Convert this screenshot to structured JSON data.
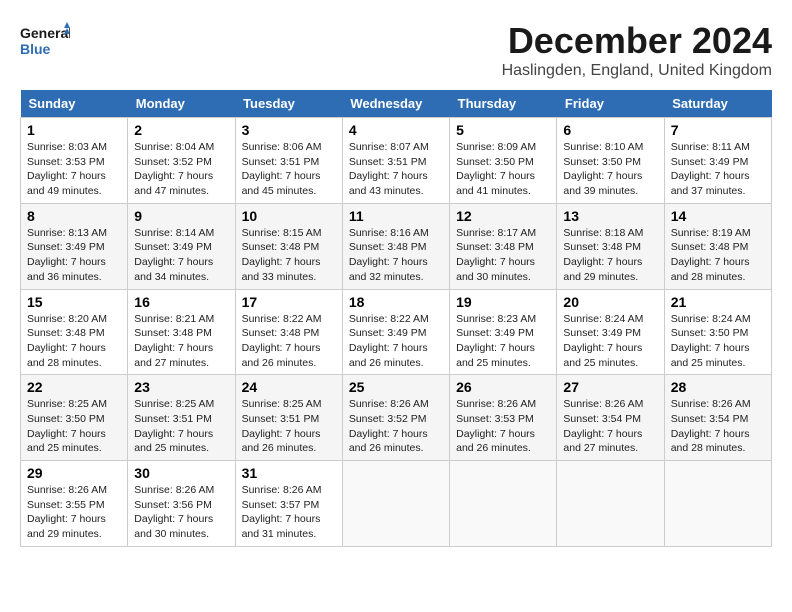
{
  "header": {
    "logo_line1": "General",
    "logo_line2": "Blue",
    "title": "December 2024",
    "subtitle": "Haslingden, England, United Kingdom"
  },
  "weekdays": [
    "Sunday",
    "Monday",
    "Tuesday",
    "Wednesday",
    "Thursday",
    "Friday",
    "Saturday"
  ],
  "weeks": [
    [
      {
        "day": "1",
        "sunrise": "Sunrise: 8:03 AM",
        "sunset": "Sunset: 3:53 PM",
        "daylight": "Daylight: 7 hours",
        "minutes": "and 49 minutes."
      },
      {
        "day": "2",
        "sunrise": "Sunrise: 8:04 AM",
        "sunset": "Sunset: 3:52 PM",
        "daylight": "Daylight: 7 hours",
        "minutes": "and 47 minutes."
      },
      {
        "day": "3",
        "sunrise": "Sunrise: 8:06 AM",
        "sunset": "Sunset: 3:51 PM",
        "daylight": "Daylight: 7 hours",
        "minutes": "and 45 minutes."
      },
      {
        "day": "4",
        "sunrise": "Sunrise: 8:07 AM",
        "sunset": "Sunset: 3:51 PM",
        "daylight": "Daylight: 7 hours",
        "minutes": "and 43 minutes."
      },
      {
        "day": "5",
        "sunrise": "Sunrise: 8:09 AM",
        "sunset": "Sunset: 3:50 PM",
        "daylight": "Daylight: 7 hours",
        "minutes": "and 41 minutes."
      },
      {
        "day": "6",
        "sunrise": "Sunrise: 8:10 AM",
        "sunset": "Sunset: 3:50 PM",
        "daylight": "Daylight: 7 hours",
        "minutes": "and 39 minutes."
      },
      {
        "day": "7",
        "sunrise": "Sunrise: 8:11 AM",
        "sunset": "Sunset: 3:49 PM",
        "daylight": "Daylight: 7 hours",
        "minutes": "and 37 minutes."
      }
    ],
    [
      {
        "day": "8",
        "sunrise": "Sunrise: 8:13 AM",
        "sunset": "Sunset: 3:49 PM",
        "daylight": "Daylight: 7 hours",
        "minutes": "and 36 minutes."
      },
      {
        "day": "9",
        "sunrise": "Sunrise: 8:14 AM",
        "sunset": "Sunset: 3:49 PM",
        "daylight": "Daylight: 7 hours",
        "minutes": "and 34 minutes."
      },
      {
        "day": "10",
        "sunrise": "Sunrise: 8:15 AM",
        "sunset": "Sunset: 3:48 PM",
        "daylight": "Daylight: 7 hours",
        "minutes": "and 33 minutes."
      },
      {
        "day": "11",
        "sunrise": "Sunrise: 8:16 AM",
        "sunset": "Sunset: 3:48 PM",
        "daylight": "Daylight: 7 hours",
        "minutes": "and 32 minutes."
      },
      {
        "day": "12",
        "sunrise": "Sunrise: 8:17 AM",
        "sunset": "Sunset: 3:48 PM",
        "daylight": "Daylight: 7 hours",
        "minutes": "and 30 minutes."
      },
      {
        "day": "13",
        "sunrise": "Sunrise: 8:18 AM",
        "sunset": "Sunset: 3:48 PM",
        "daylight": "Daylight: 7 hours",
        "minutes": "and 29 minutes."
      },
      {
        "day": "14",
        "sunrise": "Sunrise: 8:19 AM",
        "sunset": "Sunset: 3:48 PM",
        "daylight": "Daylight: 7 hours",
        "minutes": "and 28 minutes."
      }
    ],
    [
      {
        "day": "15",
        "sunrise": "Sunrise: 8:20 AM",
        "sunset": "Sunset: 3:48 PM",
        "daylight": "Daylight: 7 hours",
        "minutes": "and 28 minutes."
      },
      {
        "day": "16",
        "sunrise": "Sunrise: 8:21 AM",
        "sunset": "Sunset: 3:48 PM",
        "daylight": "Daylight: 7 hours",
        "minutes": "and 27 minutes."
      },
      {
        "day": "17",
        "sunrise": "Sunrise: 8:22 AM",
        "sunset": "Sunset: 3:48 PM",
        "daylight": "Daylight: 7 hours",
        "minutes": "and 26 minutes."
      },
      {
        "day": "18",
        "sunrise": "Sunrise: 8:22 AM",
        "sunset": "Sunset: 3:49 PM",
        "daylight": "Daylight: 7 hours",
        "minutes": "and 26 minutes."
      },
      {
        "day": "19",
        "sunrise": "Sunrise: 8:23 AM",
        "sunset": "Sunset: 3:49 PM",
        "daylight": "Daylight: 7 hours",
        "minutes": "and 25 minutes."
      },
      {
        "day": "20",
        "sunrise": "Sunrise: 8:24 AM",
        "sunset": "Sunset: 3:49 PM",
        "daylight": "Daylight: 7 hours",
        "minutes": "and 25 minutes."
      },
      {
        "day": "21",
        "sunrise": "Sunrise: 8:24 AM",
        "sunset": "Sunset: 3:50 PM",
        "daylight": "Daylight: 7 hours",
        "minutes": "and 25 minutes."
      }
    ],
    [
      {
        "day": "22",
        "sunrise": "Sunrise: 8:25 AM",
        "sunset": "Sunset: 3:50 PM",
        "daylight": "Daylight: 7 hours",
        "minutes": "and 25 minutes."
      },
      {
        "day": "23",
        "sunrise": "Sunrise: 8:25 AM",
        "sunset": "Sunset: 3:51 PM",
        "daylight": "Daylight: 7 hours",
        "minutes": "and 25 minutes."
      },
      {
        "day": "24",
        "sunrise": "Sunrise: 8:25 AM",
        "sunset": "Sunset: 3:51 PM",
        "daylight": "Daylight: 7 hours",
        "minutes": "and 26 minutes."
      },
      {
        "day": "25",
        "sunrise": "Sunrise: 8:26 AM",
        "sunset": "Sunset: 3:52 PM",
        "daylight": "Daylight: 7 hours",
        "minutes": "and 26 minutes."
      },
      {
        "day": "26",
        "sunrise": "Sunrise: 8:26 AM",
        "sunset": "Sunset: 3:53 PM",
        "daylight": "Daylight: 7 hours",
        "minutes": "and 26 minutes."
      },
      {
        "day": "27",
        "sunrise": "Sunrise: 8:26 AM",
        "sunset": "Sunset: 3:54 PM",
        "daylight": "Daylight: 7 hours",
        "minutes": "and 27 minutes."
      },
      {
        "day": "28",
        "sunrise": "Sunrise: 8:26 AM",
        "sunset": "Sunset: 3:54 PM",
        "daylight": "Daylight: 7 hours",
        "minutes": "and 28 minutes."
      }
    ],
    [
      {
        "day": "29",
        "sunrise": "Sunrise: 8:26 AM",
        "sunset": "Sunset: 3:55 PM",
        "daylight": "Daylight: 7 hours",
        "minutes": "and 29 minutes."
      },
      {
        "day": "30",
        "sunrise": "Sunrise: 8:26 AM",
        "sunset": "Sunset: 3:56 PM",
        "daylight": "Daylight: 7 hours",
        "minutes": "and 30 minutes."
      },
      {
        "day": "31",
        "sunrise": "Sunrise: 8:26 AM",
        "sunset": "Sunset: 3:57 PM",
        "daylight": "Daylight: 7 hours",
        "minutes": "and 31 minutes."
      },
      null,
      null,
      null,
      null
    ]
  ]
}
